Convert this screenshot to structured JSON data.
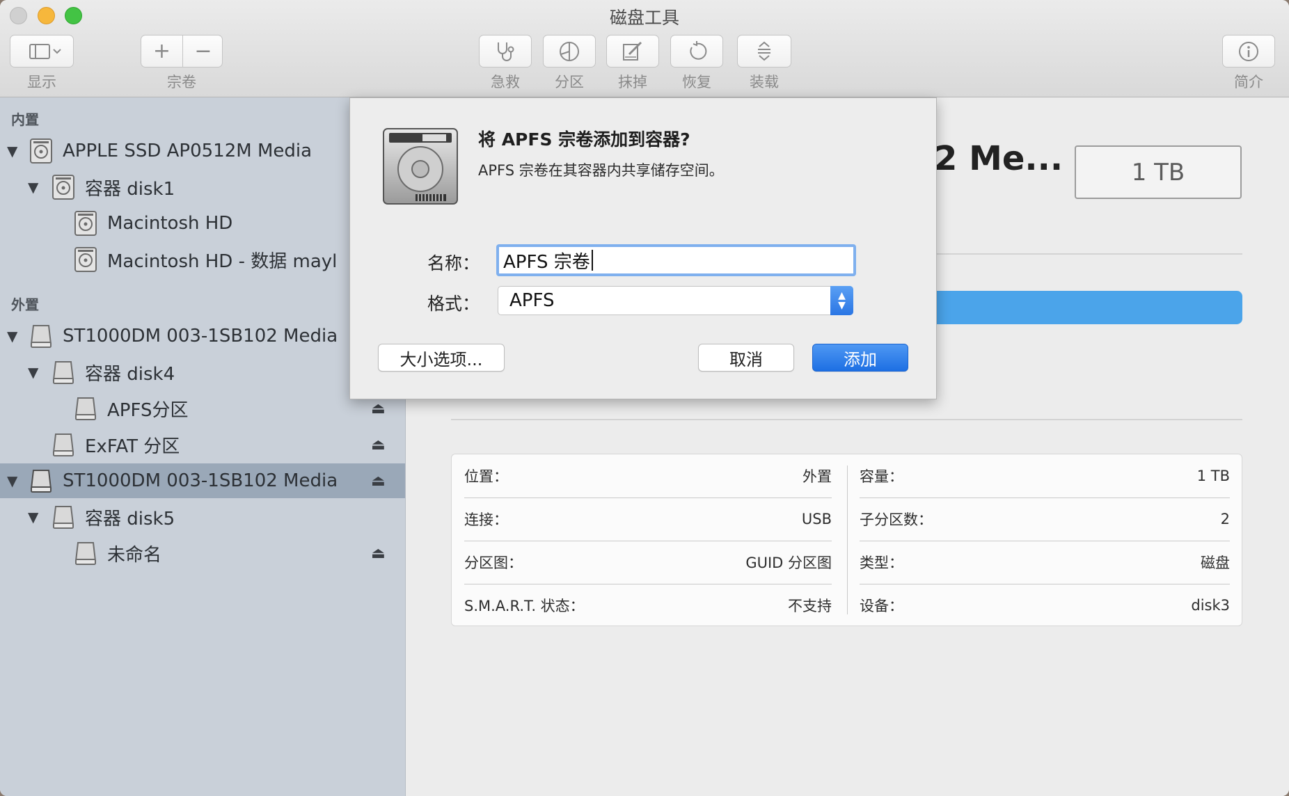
{
  "window": {
    "title": "磁盘工具"
  },
  "toolbar": {
    "view_label": "显示",
    "volume_label": "宗卷",
    "add_symbol": "+",
    "remove_symbol": "−",
    "first_aid_label": "急救",
    "partition_label": "分区",
    "erase_label": "抹掉",
    "restore_label": "恢复",
    "mount_label": "装载",
    "info_label": "简介"
  },
  "sidebar": {
    "internal_header": "内置",
    "external_header": "外置",
    "items": [
      {
        "label": "APPLE SSD AP0512M Media"
      },
      {
        "label": "容器 disk1"
      },
      {
        "label": "Macintosh HD"
      },
      {
        "label": "Macintosh HD - 数据 mayl"
      },
      {
        "label": "ST1000DM 003-1SB102 Media"
      },
      {
        "label": "容器 disk4"
      },
      {
        "label": "APFS分区"
      },
      {
        "label": "ExFAT 分区"
      },
      {
        "label": "ST1000DM 003-1SB102 Media"
      },
      {
        "label": "容器 disk5"
      },
      {
        "label": "未命名"
      }
    ]
  },
  "main": {
    "disk_title": "2 Me...",
    "size_box": "1 TB",
    "info": {
      "location_key": "位置：",
      "location_val": "外置",
      "connection_key": "连接：",
      "connection_val": "USB",
      "partition_map_key": "分区图：",
      "partition_map_val": "GUID 分区图",
      "smart_key": "S.M.A.R.T. 状态：",
      "smart_val": "不支持",
      "capacity_key": "容量：",
      "capacity_val": "1 TB",
      "children_key": "子分区数：",
      "children_val": "2",
      "type_key": "类型：",
      "type_val": "磁盘",
      "device_key": "设备：",
      "device_val": "disk3"
    }
  },
  "dialog": {
    "title": "将 APFS 宗卷添加到容器?",
    "message": "APFS 宗卷在其容器内共享储存空间。",
    "name_label": "名称：",
    "name_value": "APFS 宗卷",
    "format_label": "格式：",
    "format_value": "APFS",
    "size_options_button": "大小选项...",
    "cancel_button": "取消",
    "add_button": "添加"
  },
  "colors": {
    "accent": "#2a76e4",
    "sidebar_bg": "#c9d0d9",
    "sidebar_selected": "#9aa8b8",
    "usage_bar": "#4ba4ea"
  }
}
